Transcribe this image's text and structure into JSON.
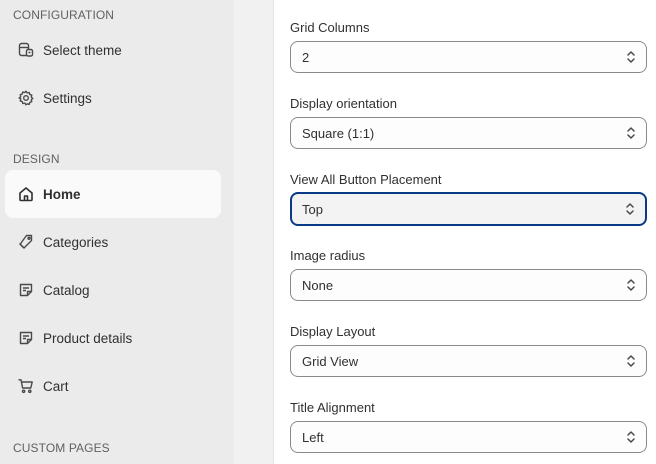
{
  "sidebar": {
    "sections": {
      "configuration": "CONFIGURATION",
      "design": "DESIGN",
      "custom_pages": "CUSTOM PAGES"
    },
    "items": {
      "select_theme": {
        "label": "Select theme",
        "icon": "theme-icon"
      },
      "settings": {
        "label": "Settings",
        "icon": "gear-icon"
      },
      "home": {
        "label": "Home",
        "icon": "home-icon",
        "active": true
      },
      "categories": {
        "label": "Categories",
        "icon": "tag-icon"
      },
      "catalog": {
        "label": "Catalog",
        "icon": "note-icon"
      },
      "product_details": {
        "label": "Product details",
        "icon": "note-icon"
      },
      "cart": {
        "label": "Cart",
        "icon": "cart-icon"
      }
    }
  },
  "settings_panel": {
    "grid_columns": {
      "label": "Grid Columns",
      "value": "2"
    },
    "display_orientation": {
      "label": "Display orientation",
      "value": "Square (1:1)"
    },
    "view_all_placement": {
      "label": "View All Button Placement",
      "value": "Top",
      "focused": true
    },
    "image_radius": {
      "label": "Image radius",
      "value": "None"
    },
    "display_layout": {
      "label": "Display Layout",
      "value": "Grid View"
    },
    "title_alignment": {
      "label": "Title Alignment",
      "value": "Left"
    }
  },
  "colors": {
    "sidebar_bg": "#ebebeb",
    "active_item_bg": "#fafafa",
    "focus_border": "#0a3a87",
    "text": "#303030"
  }
}
